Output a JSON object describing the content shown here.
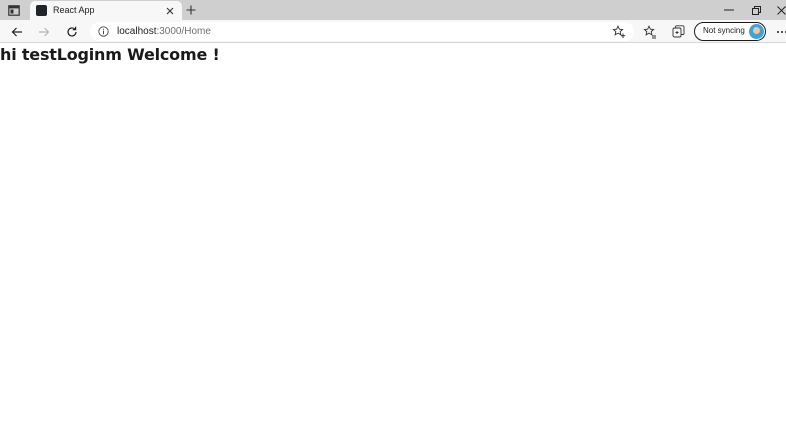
{
  "browser": {
    "tab": {
      "title": "React App"
    },
    "address_bar": {
      "url_host": "localhost",
      "url_path": ":3000/Home"
    },
    "profile": {
      "label": "Not syncing"
    },
    "icons": {
      "tab_actions": "tab-actions-icon",
      "close": "close-icon",
      "new_tab": "plus-icon",
      "back": "back-arrow-icon",
      "forward": "forward-arrow-icon",
      "refresh": "refresh-icon",
      "info": "info-icon",
      "add_favorite": "add-favorite-icon",
      "favorites": "favorites-icon",
      "collections": "collections-icon",
      "more": "more-icon"
    },
    "colors": {
      "tab_strip": "#cfcfcf",
      "toolbar": "#f7f7f7",
      "avatar": "#3da3d8"
    }
  },
  "page": {
    "greeting": "hi testLoginm Welcome !"
  }
}
